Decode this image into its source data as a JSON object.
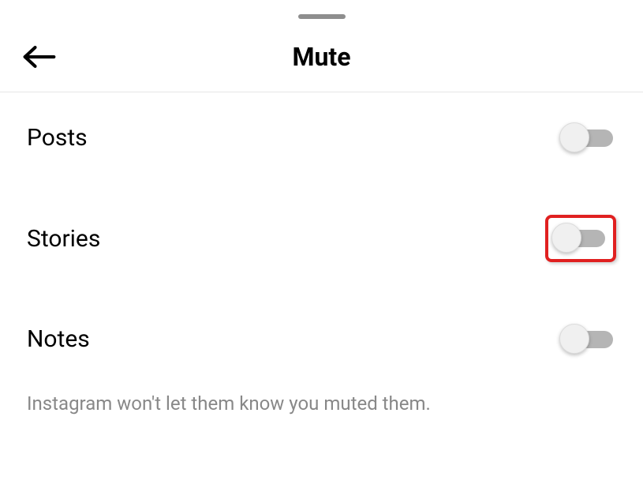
{
  "header": {
    "title": "Mute"
  },
  "settings": {
    "posts": {
      "label": "Posts",
      "enabled": false
    },
    "stories": {
      "label": "Stories",
      "enabled": false,
      "highlighted": true
    },
    "notes": {
      "label": "Notes",
      "enabled": false
    }
  },
  "footer": {
    "text": "Instagram won't let them know you muted them."
  }
}
